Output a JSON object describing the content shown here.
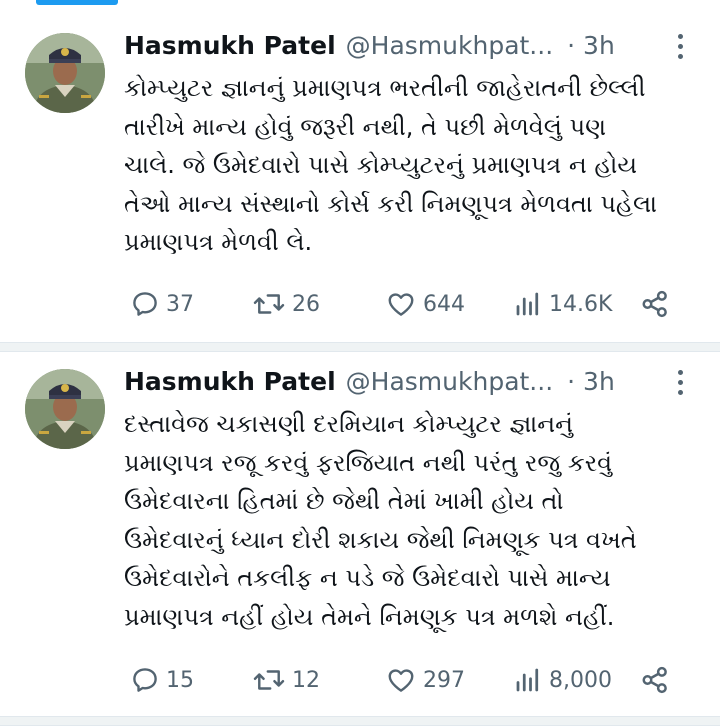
{
  "tweets": [
    {
      "author_name": "Hasmukh Patel",
      "handle": "@Hasmukhpat...",
      "time": "· 3h",
      "text_lines": [
        "કોમ્પ્યુટર જ્ઞાનનું પ્રમાણપત્ર ભરતીની જાહેરાતની છેલ્લી",
        "તારીખે માન્ય હોવું જરૂરી નથી, તે પછી મેળવેલું પણ",
        "ચાલે. જે ઉમેદવારો પાસે કોમ્પ્યુટરનું પ્રમાણપત્ર ન હોય",
        "તેઓ માન્ય સંસ્થાનો કોર્સ કરી નિમણૂપત્ર મેળવતા પહેલા",
        "પ્રમાણપત્ર મેળવી લે."
      ],
      "replies": "37",
      "retweets": "26",
      "likes": "644",
      "views": "14.6K"
    },
    {
      "author_name": "Hasmukh Patel",
      "handle": "@Hasmukhpat...",
      "time": "· 3h",
      "text_lines": [
        "દસ્તાવેજ ચકાસણી દરમિયાન કોમ્પ્યુટર જ્ઞાનનું",
        "પ્રમાણપત્ર રજૂ કરવું ફરજિયાત નથી પરંતુ રજુ કરવું",
        "ઉમેદવારના હિતમાં છે જેથી તેમાં ખામી હોય તો",
        "ઉમેદવારનું ધ્યાન દોરી શકાય જેથી નિમણૂક પત્ર વખતે",
        "ઉમેદવારોને તકલીફ ન પડે જે ઉમેદવારો પાસે માન્ય",
        "પ્રમાણપત્ર નહીં હોય તેમને નિમણૂક પત્ર મળશે નહીં."
      ],
      "replies": "15",
      "retweets": "12",
      "likes": "297",
      "views": "8,000"
    }
  ],
  "icons": {
    "reply": "reply-icon",
    "retweet": "retweet-icon",
    "like": "heart-icon",
    "views": "views-icon",
    "share": "share-icon",
    "more": "more-icon"
  },
  "colors": {
    "text": "#0f1419",
    "secondary": "#536471",
    "accent": "#1d9bf0",
    "divider": "#eff3f4"
  }
}
